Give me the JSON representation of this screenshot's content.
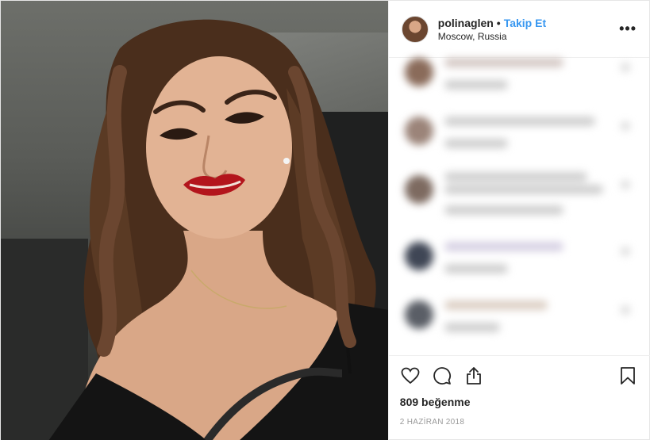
{
  "header": {
    "username": "polinaglen",
    "separator": "•",
    "follow_label": "Takip Et",
    "location": "Moscow, Russia",
    "more_icon": "more-horizontal-icon"
  },
  "photo": {
    "description_icon": "post-photo"
  },
  "actions": {
    "like_icon": "heart-icon",
    "comment_icon": "comment-icon",
    "share_icon": "share-icon",
    "save_icon": "bookmark-icon"
  },
  "likes": "809 beğenme",
  "date": "2 HAZİRAN 2018",
  "colors": {
    "accent": "#3897f0",
    "text": "#262626",
    "muted": "#999999",
    "border": "#efefef"
  }
}
